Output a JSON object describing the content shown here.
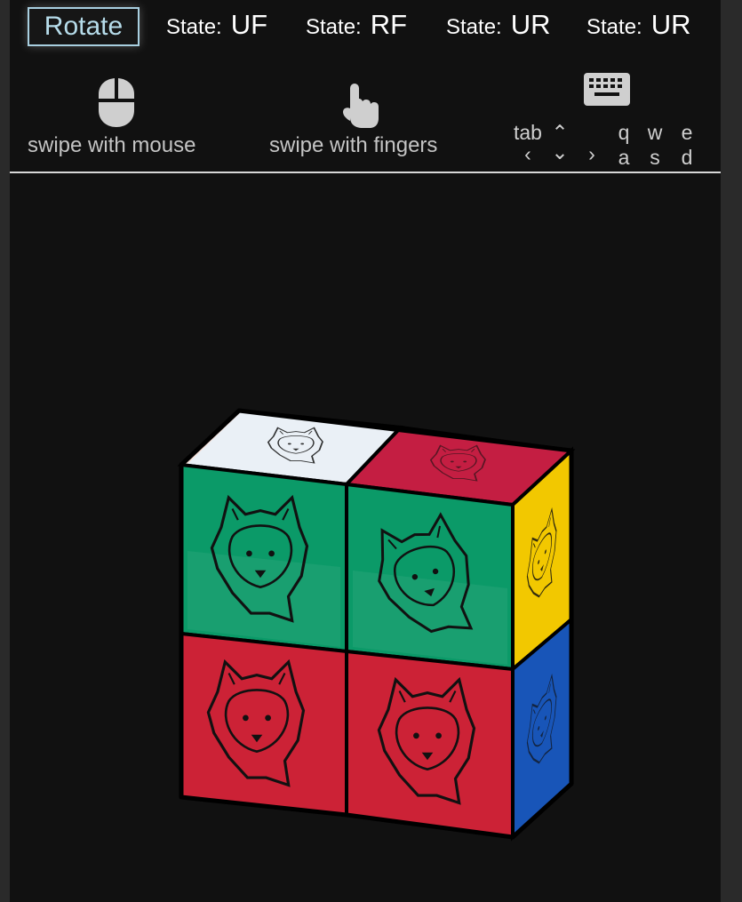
{
  "toolbar": {
    "rotate_label": "Rotate",
    "state_label": "State:",
    "states": [
      "UF",
      "RF",
      "UR",
      "UR"
    ]
  },
  "controls": {
    "mouse_label": "swipe with mouse",
    "fingers_label": "swipe with fingers",
    "keys": {
      "tab": "tab",
      "up": "⌃",
      "left": "‹",
      "down": "⌄",
      "right": "›",
      "q": "q",
      "w": "w",
      "e": "e",
      "a": "a",
      "s": "s",
      "d": "d"
    },
    "icons": [
      "mouse-icon",
      "pointer-hand-icon",
      "keyboard-icon"
    ]
  },
  "cube": {
    "type": "2x2 puzzle cube with animal faces",
    "front_top_left": "#0b9a68",
    "front_top_right": "#0b9a68",
    "front_bottom_left": "#cc2236",
    "front_bottom_right": "#cc2236",
    "top_left": "#e9eef3",
    "top_right": "#c41e42",
    "right_top": "#f2c800",
    "right_bottom": "#1855b8"
  }
}
